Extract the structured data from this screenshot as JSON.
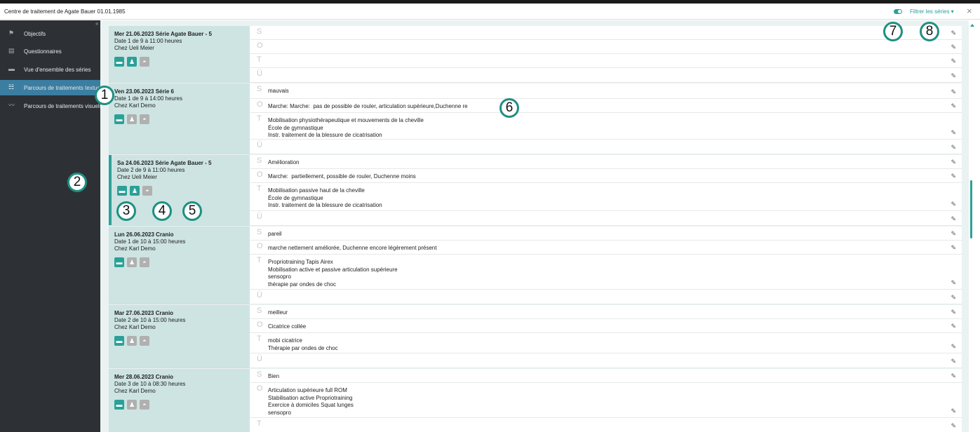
{
  "window": {
    "title": "Centre de traitement de Agate Bauer 01.01.1985",
    "filter_label": "Filtrer les séries",
    "close_icon": "×"
  },
  "colors": {
    "accent": "#2aa198",
    "sidebar": "#2d3136",
    "active": "#3b7ea1"
  },
  "sidebar": {
    "items": [
      {
        "label": "Objectifs",
        "icon": "flag-icon"
      },
      {
        "label": "Questionnaires",
        "icon": "questionnaire-icon"
      },
      {
        "label": "Vue d'ensemble des séries",
        "icon": "folder-icon"
      },
      {
        "label": "Parcours de traitements textuels",
        "icon": "list-icon",
        "active": true
      },
      {
        "label": "Parcours de traitements visuels",
        "icon": "chart-icon"
      }
    ]
  },
  "letters": {
    "s": "S",
    "o": "O",
    "t": "T",
    "u": "Ü"
  },
  "entries": [
    {
      "header": "Mer 21.06.2023 Série Agate Bauer - 5",
      "line2": "Date 1 de 9 à 11:00 heures",
      "line3": "Chez Ueli  Meier",
      "s": "",
      "o": "",
      "t": "",
      "u": ""
    },
    {
      "header": "Ven 23.06.2023 Série 6",
      "line2": "Date 1 de 9 à 14:00 heures",
      "line3": "Chez Karl Demo",
      "s": "mauvais",
      "o": "Marche: Marche:  pas de possible de rouler, articulation supérieure,Duchenne re",
      "t": "Mobilisation physiothérapeutique et mouvements de la cheville\nÉcole de gymnastique\nInstr. traitement de la blessure de cicatrisation",
      "u": ""
    },
    {
      "header": "Sa 24.06.2023 Série Agate Bauer - 5",
      "line2": "Date 2 de 9 à 11:00 heures",
      "line3": "Chez Ueli  Meier",
      "s": "Amélioration",
      "o": "Marche:  partiellement, possible de rouler, Duchenne moins",
      "t": "Mobilisation passive haut de la cheville\nÉcole de gymnastique\nInstr. traitement de la blessure de cicatrisation",
      "u": ""
    },
    {
      "header": "Lun 26.06.2023 Cranio",
      "line2": "Date 1 de 10 à 15:00 heures",
      "line3": "Chez Karl Demo",
      "s": "pareil",
      "o": "marche nettement améliorée, Duchenne encore légèrement présent",
      "t": "Propriotraining Tapis Airex\nMobilisation active et passive articulation supérieure\nsensopro\nthérapie par ondes de choc",
      "u": ""
    },
    {
      "header": "Mar 27.06.2023 Cranio",
      "line2": "Date 2 de 10 à 15:00 heures",
      "line3": "Chez Karl Demo",
      "s": "meilleur",
      "o": "Cicatrice collée",
      "t": "mobi cicatrice\nThérapie par ondes de choc",
      "u": ""
    },
    {
      "header": "Mer 28.06.2023 Cranio",
      "line2": "Date 3 de 10 à 08:30 heures",
      "line3": "Chez Karl Demo",
      "s": "Bien",
      "o": "Articulation supérieure full ROM\nStabilisation active Propriotraining\nExercice à domiciles Squat lunges\nsensopro",
      "t": "",
      "u": ""
    }
  ],
  "callouts": [
    "1",
    "2",
    "3",
    "4",
    "5",
    "6",
    "7",
    "8"
  ]
}
